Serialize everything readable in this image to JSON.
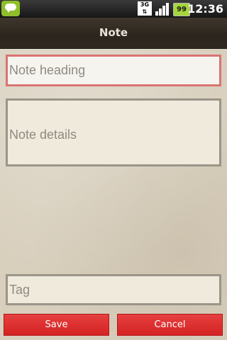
{
  "status_bar": {
    "network": "3G",
    "battery": "99",
    "time": "12:36",
    "icons": [
      "chat-bubble-icon",
      "network-3g-icon",
      "signal-icon",
      "battery-icon"
    ]
  },
  "header": {
    "title": "Note"
  },
  "form": {
    "heading_placeholder": "Note heading",
    "details_placeholder": "Note details",
    "tag_placeholder": "Tag"
  },
  "actions": {
    "save_label": "Save",
    "cancel_label": "Cancel"
  },
  "colors": {
    "button_red": "#dd2b2b",
    "focus_border": "#d97474",
    "title_bar": "#2f2820"
  }
}
